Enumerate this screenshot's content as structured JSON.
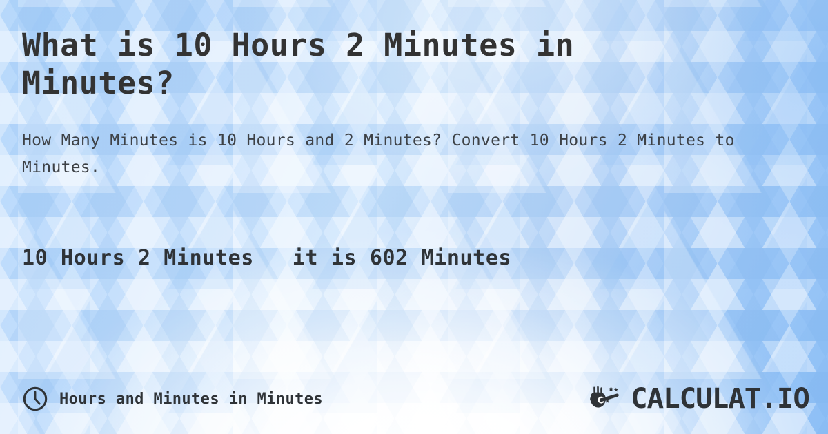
{
  "page": {
    "headline": "What is 10 Hours 2 Minutes in Minutes?",
    "subheadline": "How Many Minutes is 10 Hours and 2 Minutes? Convert 10 Hours 2 Minutes to Minutes.",
    "result_line": "10 Hours 2 Minutes   it is 602 Minutes"
  },
  "result": {
    "input_value": "10 Hours 2 Minutes",
    "connector": "it is",
    "output_value": "602 Minutes",
    "output_number": "602",
    "output_unit": "Minutes"
  },
  "footer": {
    "category_label": "Hours and Minutes in Minutes",
    "clock_icon": "clock-icon"
  },
  "brand": {
    "name": "CALCULAT.IO",
    "mark_icon": "hand-magic-wand-icon"
  },
  "colors": {
    "headline_text": "#333333",
    "subheadline_text": "#3d4146",
    "result_text": "#2f3337",
    "footer_text": "#2f3337",
    "brand_text": "#2f3337",
    "background_blue": "#8dbff6",
    "background_light": "#ffffff"
  }
}
